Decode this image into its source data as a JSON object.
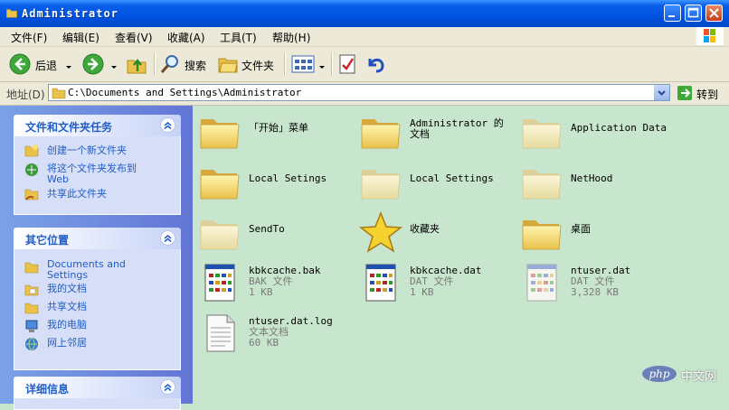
{
  "window": {
    "title": "Administrator"
  },
  "menu": [
    "文件(F)",
    "编辑(E)",
    "查看(V)",
    "收藏(A)",
    "工具(T)",
    "帮助(H)"
  ],
  "toolbar": {
    "back": "后退",
    "search": "搜索",
    "folders": "文件夹"
  },
  "address": {
    "label": "地址(D)",
    "path": "C:\\Documents and Settings\\Administrator",
    "go": "转到"
  },
  "tasks": {
    "title": "文件和文件夹任务",
    "items": [
      "创建一个新文件夹",
      "将这个文件夹发布到 Web",
      "共享此文件夹"
    ]
  },
  "places": {
    "title": "其它位置",
    "items": [
      "Documents and Settings",
      "我的文档",
      "共享文档",
      "我的电脑",
      "网上邻居"
    ]
  },
  "details": {
    "title": "详细信息"
  },
  "files": [
    {
      "name": "「开始」菜单",
      "type": "folder"
    },
    {
      "name": "Administrator 的文档",
      "type": "folder"
    },
    {
      "name": "Application Data",
      "type": "folder-faded"
    },
    {
      "name": "Local Setings",
      "type": "folder"
    },
    {
      "name": "Local Settings",
      "type": "folder-faded"
    },
    {
      "name": "NetHood",
      "type": "folder-faded"
    },
    {
      "name": "SendTo",
      "type": "folder-faded"
    },
    {
      "name": "收藏夹",
      "type": "star"
    },
    {
      "name": "桌面",
      "type": "folder"
    },
    {
      "name": "kbkcache.bak",
      "type": "file",
      "kind": "BAK 文件",
      "size": "1 KB"
    },
    {
      "name": "kbkcache.dat",
      "type": "file",
      "kind": "DAT 文件",
      "size": "1 KB"
    },
    {
      "name": "ntuser.dat",
      "type": "file-faded",
      "kind": "DAT 文件",
      "size": "3,328 KB"
    },
    {
      "name": "ntuser.dat.log",
      "type": "text",
      "kind": "文本文档",
      "size": "60 KB"
    }
  ],
  "watermark": {
    "logo": "php",
    "text": "中文网"
  }
}
